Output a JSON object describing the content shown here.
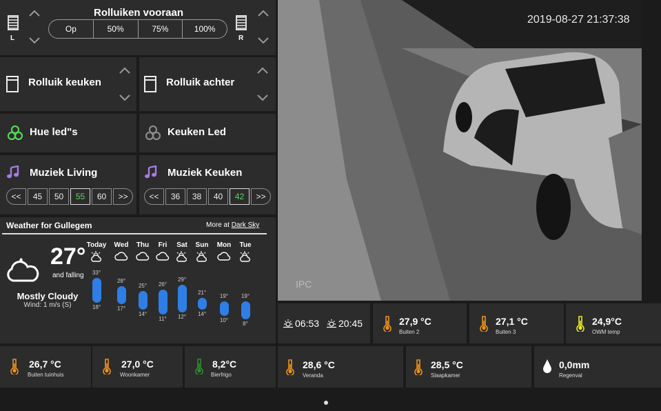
{
  "shutter_front": {
    "title": "Rolluiken vooraan",
    "left_label": "L",
    "right_label": "R",
    "buttons": [
      "Op",
      "50%",
      "75%",
      "100%"
    ]
  },
  "shutters": [
    {
      "label": "Rolluik keuken"
    },
    {
      "label": "Rolluik achter"
    }
  ],
  "lights": [
    {
      "label": "Hue led\"s",
      "state_color": "#57d657"
    },
    {
      "label": "Keuken Led",
      "state_color": "#8a8a8a"
    }
  ],
  "music": [
    {
      "label": "Muziek Living",
      "buttons": [
        "<<",
        "45",
        "50",
        "55",
        "60",
        ">>"
      ],
      "active": "55"
    },
    {
      "label": "Muziek Keuken",
      "buttons": [
        "<<",
        "36",
        "38",
        "40",
        "42",
        ">>"
      ],
      "active": "42"
    }
  ],
  "weather": {
    "title": "Weather for Gullegem",
    "more_text": "More at",
    "more_link": "Dark Sky",
    "current_temp": "27°",
    "trend": "and falling",
    "summary": "Mostly Cloudy",
    "wind": "Wind: 1 m/s (S)",
    "days": [
      {
        "name": "Today",
        "high": "33°",
        "low": "18°",
        "high_val": 33,
        "low_val": 18,
        "icon": "partly-cloudy-day-icon"
      },
      {
        "name": "Wed",
        "high": "28°",
        "low": "17°",
        "high_val": 28,
        "low_val": 17,
        "icon": "cloud-icon"
      },
      {
        "name": "Thu",
        "high": "25°",
        "low": "14°",
        "high_val": 25,
        "low_val": 14,
        "icon": "cloud-icon"
      },
      {
        "name": "Fri",
        "high": "26°",
        "low": "11°",
        "high_val": 26,
        "low_val": 11,
        "icon": "cloud-icon"
      },
      {
        "name": "Sat",
        "high": "29°",
        "low": "12°",
        "high_val": 29,
        "low_val": 12,
        "icon": "partly-cloudy-day-icon"
      },
      {
        "name": "Sun",
        "high": "21°",
        "low": "14°",
        "high_val": 21,
        "low_val": 14,
        "icon": "partly-cloudy-day-icon"
      },
      {
        "name": "Mon",
        "high": "19°",
        "low": "10°",
        "high_val": 19,
        "low_val": 10,
        "icon": "cloud-icon"
      },
      {
        "name": "Tue",
        "high": "19°",
        "low": "8°",
        "high_val": 19,
        "low_val": 8,
        "icon": "partly-cloudy-day-icon"
      }
    ]
  },
  "camera": {
    "timestamp": "2019-08-27 21:37:38",
    "watermark": "IPC"
  },
  "sun": {
    "sunrise": "06:53",
    "sunset": "20:45"
  },
  "sensors": [
    {
      "value": "27,9 °C",
      "label": "Buiten 2",
      "color": "#f0921a"
    },
    {
      "value": "27,1 °C",
      "label": "Buiten 3",
      "color": "#f0921a"
    },
    {
      "value": "24,9°C",
      "label": "OWM temp",
      "color": "#ecec1a"
    },
    {
      "value": "26,7 °C",
      "label": "Buiten tuinhuis",
      "color": "#f0921a"
    },
    {
      "value": "27,0 °C",
      "label": "Woonkamer",
      "color": "#f0921a"
    },
    {
      "value": "8,2°C",
      "label": "Bierfrigo",
      "color": "#2c8f2c"
    },
    {
      "value": "28,6 °C",
      "label": "Veranda",
      "color": "#f0921a"
    },
    {
      "value": "28,5 °C",
      "label": "Slaapkamer",
      "color": "#f0921a"
    },
    {
      "value": "0,0mm",
      "label": "Regenval",
      "color": "#ffffff"
    }
  ]
}
